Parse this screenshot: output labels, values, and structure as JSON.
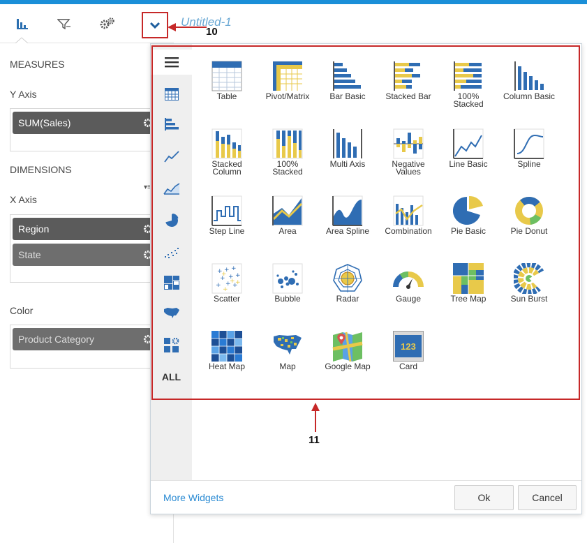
{
  "app": {
    "document_title": "Untitled-1",
    "callouts": {
      "dropdown": "10",
      "gallery": "11"
    }
  },
  "toolbar": {
    "items": [
      {
        "name": "chart-tab-icon"
      },
      {
        "name": "filter-tab-icon"
      },
      {
        "name": "settings-tab-icon"
      },
      {
        "name": "chevron-down-icon"
      }
    ]
  },
  "left_panel": {
    "measures": {
      "title": "MEASURES",
      "y_axis_label": "Y Axis",
      "y_axis_fields": [
        "SUM(Sales)"
      ]
    },
    "dimensions": {
      "title": "DIMENSIONS",
      "x_axis_label": "X Axis",
      "x_axis_fields": [
        "Region",
        "State"
      ]
    },
    "color": {
      "label": "Color",
      "fields": [
        "Product Category"
      ]
    }
  },
  "widget_picker": {
    "rail": [
      {
        "name": "list-icon"
      },
      {
        "name": "table-icon"
      },
      {
        "name": "bar-chart-icon"
      },
      {
        "name": "line-chart-icon"
      },
      {
        "name": "area-chart-icon"
      },
      {
        "name": "pie-chart-icon"
      },
      {
        "name": "scatter-icon"
      },
      {
        "name": "treemap-icon"
      },
      {
        "name": "map-icon"
      },
      {
        "name": "widgets-icon"
      }
    ],
    "rail_all_label": "ALL",
    "widgets": [
      {
        "label": "Table",
        "icon": "table"
      },
      {
        "label": "Pivot/Matrix",
        "icon": "pivot"
      },
      {
        "label": "Bar Basic",
        "icon": "bar-basic"
      },
      {
        "label": "Stacked Bar",
        "icon": "stacked-bar"
      },
      {
        "label": "100%\nStacked",
        "icon": "stacked-bar-100"
      },
      {
        "label": "Column Basic",
        "icon": "column-basic"
      },
      {
        "label": "Stacked\nColumn",
        "icon": "stacked-column"
      },
      {
        "label": "100%\nStacked",
        "icon": "stacked-column-100"
      },
      {
        "label": "Multi Axis",
        "icon": "multi-axis"
      },
      {
        "label": "Negative\nValues",
        "icon": "negative-values"
      },
      {
        "label": "Line Basic",
        "icon": "line-basic"
      },
      {
        "label": "Spline",
        "icon": "spline"
      },
      {
        "label": "Step Line",
        "icon": "step-line"
      },
      {
        "label": "Area",
        "icon": "area"
      },
      {
        "label": "Area Spline",
        "icon": "area-spline"
      },
      {
        "label": "Combination",
        "icon": "combination"
      },
      {
        "label": "Pie Basic",
        "icon": "pie-basic"
      },
      {
        "label": "Pie Donut",
        "icon": "pie-donut"
      },
      {
        "label": "Scatter",
        "icon": "scatter"
      },
      {
        "label": "Bubble",
        "icon": "bubble"
      },
      {
        "label": "Radar",
        "icon": "radar"
      },
      {
        "label": "Gauge",
        "icon": "gauge"
      },
      {
        "label": "Tree Map",
        "icon": "tree-map"
      },
      {
        "label": "Sun Burst",
        "icon": "sun-burst"
      },
      {
        "label": "Heat Map",
        "icon": "heat-map"
      },
      {
        "label": "Map",
        "icon": "map"
      },
      {
        "label": "Google Map",
        "icon": "google-map"
      },
      {
        "label": "Card",
        "icon": "card",
        "value": "123"
      }
    ],
    "footer": {
      "more_widgets": "More Widgets",
      "ok": "Ok",
      "cancel": "Cancel"
    }
  },
  "colors": {
    "accent": "#1a8fd8",
    "chart_blue": "#2f6db3",
    "chart_yellow": "#e8c94a",
    "highlight_red": "#c62828"
  }
}
